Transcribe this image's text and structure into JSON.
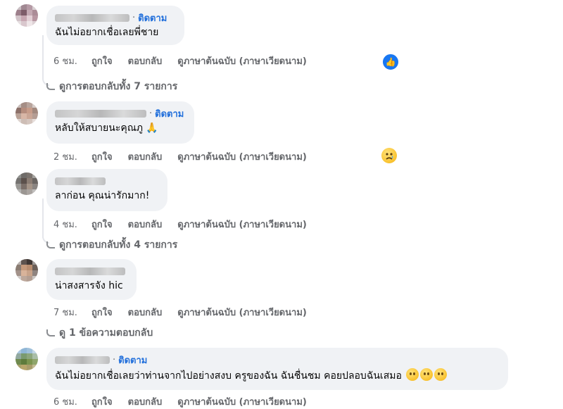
{
  "comments": [
    {
      "follow": "ติดตาม",
      "text": "ฉันไม่อยากเชื่อเลยพี่ชาย",
      "time": "6 ชม.",
      "like": "ถูกใจ",
      "reply": "ตอบกลับ",
      "translate": "ดูภาษาต้นฉบับ (ภาษาเวียดนาม)",
      "reaction": "like-icon",
      "view_replies": "ดูการตอบกลับทั้ง 7 รายการ"
    },
    {
      "follow": "ติดตาม",
      "text": "หลับให้สบายนะคุณภู",
      "emoji": "🙏",
      "time": "2 ชม.",
      "like": "ถูกใจ",
      "reply": "ตอบกลับ",
      "translate": "ดูภาษาต้นฉบับ (ภาษาเวียดนาม)",
      "reaction": "sad-icon"
    },
    {
      "text": "ลาก่อน คุณน่ารักมาก!",
      "time": "4 ชม.",
      "like": "ถูกใจ",
      "reply": "ตอบกลับ",
      "translate": "ดูภาษาต้นฉบับ (ภาษาเวียดนาม)",
      "view_replies": "ดูการตอบกลับทั้ง 4 รายการ"
    },
    {
      "text": "น่าสงสารจัง hic",
      "time": "7 ชม.",
      "like": "ถูกใจ",
      "reply": "ตอบกลับ",
      "translate": "ดูภาษาต้นฉบับ (ภาษาเวียดนาม)",
      "view_replies": "ดู 1 ข้อความตอบกลับ"
    },
    {
      "follow": "ติดตาม",
      "text": "ฉันไม่อยากเชื่อเลยว่าท่านจากไปอย่างสงบ ครูของฉัน ฉันชื่นชม คอยปลอบฉันเสมอ",
      "time": "6 ชม.",
      "like": "ถูกใจ",
      "reply": "ตอบกลับ",
      "translate": "ดูภาษาต้นฉบับ (ภาษาเวียดนาม)"
    }
  ],
  "colors": {
    "bubble": "#f0f2f5",
    "follow": "#216fdb",
    "meta": "#65676b",
    "like_reaction": "#1877f2"
  }
}
